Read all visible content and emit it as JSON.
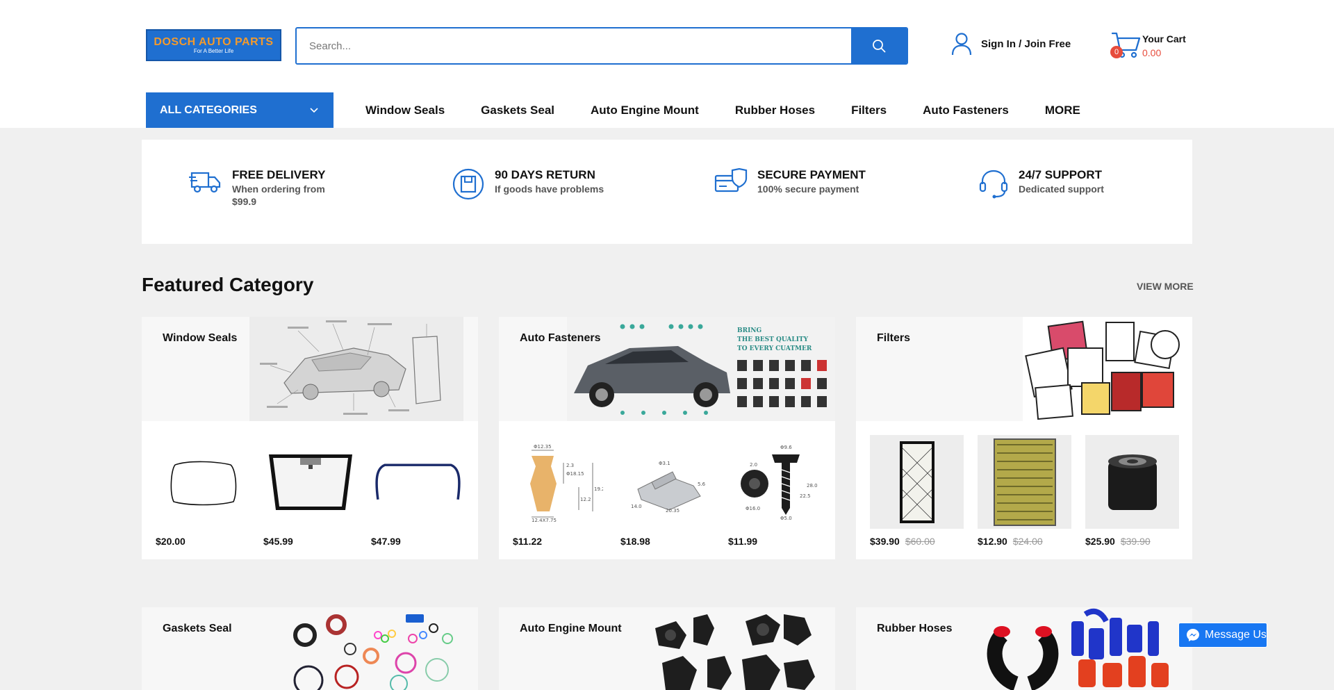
{
  "header": {
    "logo_line1": "DOSCH AUTO PARTS",
    "logo_line2": "For A Better Life",
    "search_placeholder": "Search...",
    "signin": "Sign In",
    "separator": "/",
    "join": "Join Free",
    "cart_count": "0",
    "cart_label": "Your Cart",
    "cart_total": "0.00"
  },
  "nav": {
    "all_categories": "ALL CATEGORIES",
    "links": [
      "Window Seals",
      "Gaskets Seal",
      "Auto Engine Mount",
      "Rubber Hoses",
      "Filters",
      "Auto Fasteners",
      "MORE"
    ]
  },
  "features": [
    {
      "title": "FREE DELIVERY",
      "sub": "When ordering from",
      "sub2": "$99.9",
      "icon": "truck-icon"
    },
    {
      "title": "90 DAYS RETURN",
      "sub": "If goods have problems",
      "icon": "return-box-icon"
    },
    {
      "title": "SECURE PAYMENT",
      "sub": "100% secure payment",
      "icon": "secure-card-icon"
    },
    {
      "title": "24/7 SUPPORT",
      "sub": "Dedicated support",
      "icon": "headset-icon"
    }
  ],
  "featured": {
    "title": "Featured Category",
    "view_more": "VIEW MORE",
    "cards": [
      {
        "title": "Window Seals",
        "products": [
          {
            "price": "$20.00"
          },
          {
            "price": "$45.99"
          },
          {
            "price": "$47.99"
          }
        ]
      },
      {
        "title": "Auto Fasteners",
        "banner_text1": "BRING",
        "banner_text2": "THE BEST QUALITY",
        "banner_text3": "TO EVERY CUATMER",
        "products": [
          {
            "price": "$11.22"
          },
          {
            "price": "$18.98"
          },
          {
            "price": "$11.99"
          }
        ]
      },
      {
        "title": "Filters",
        "products": [
          {
            "price": "$39.90",
            "old": "$60.00"
          },
          {
            "price": "$12.90",
            "old": "$24.00"
          },
          {
            "price": "$25.90",
            "old": "$39.90"
          }
        ]
      },
      {
        "title": "Gaskets Seal"
      },
      {
        "title": "Auto Engine Mount"
      },
      {
        "title": "Rubber Hoses"
      }
    ]
  },
  "messenger": {
    "label": "Message Us"
  },
  "colors": {
    "accent": "#1f6fd0",
    "cart_red": "#e74c3c",
    "background": "#f0f0f0"
  }
}
